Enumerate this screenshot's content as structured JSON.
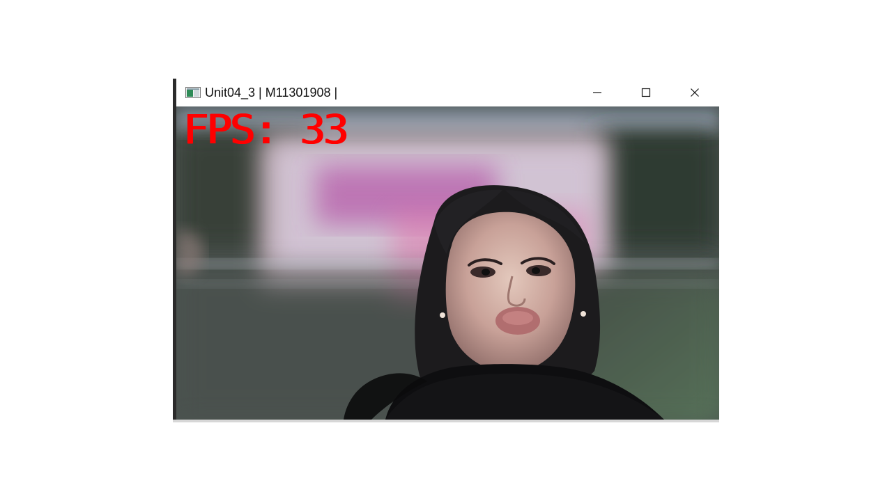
{
  "window": {
    "title": "Unit04_3 | M11301908 |",
    "icon": "app-window-icon"
  },
  "controls": {
    "minimize": "minimize-icon",
    "maximize": "maximize-icon",
    "close": "close-icon"
  },
  "overlay": {
    "fps_text": "FPS: 33",
    "fps_color": "#ff0000"
  },
  "scene": {
    "subject": "woman-face-video-frame",
    "background": "blurred-pink-sign"
  }
}
